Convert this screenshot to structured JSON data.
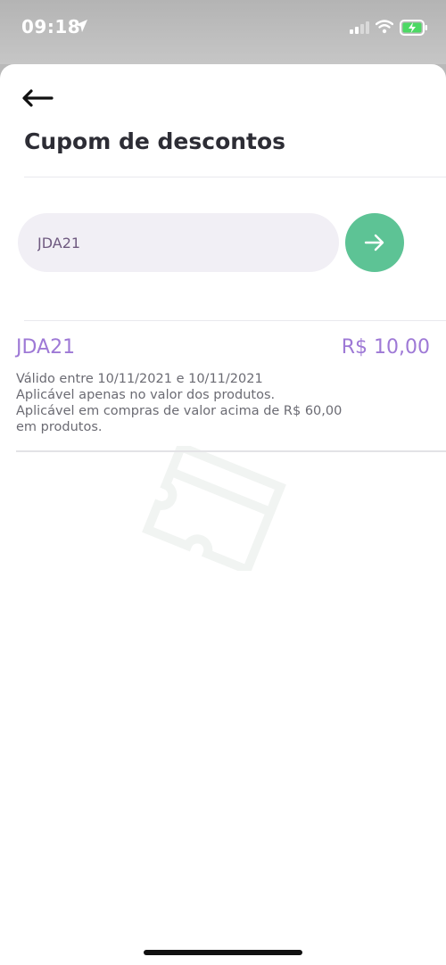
{
  "status_bar": {
    "time": "09:18",
    "icons": [
      "location-arrow-icon",
      "cell-signal-icon",
      "wifi-icon",
      "battery-charging-icon"
    ],
    "battery_color": "#4cd964"
  },
  "header": {
    "back_icon": "arrow-left-icon",
    "title": "Cupom de descontos"
  },
  "coupon_form": {
    "input_value": "JDA21",
    "submit_icon": "arrow-right-icon",
    "submit_color": "#5dc395"
  },
  "coupons": [
    {
      "code": "JDA21",
      "value": "R$ 10,00",
      "lines": [
        "Válido entre 10/11/2021 e 10/11/2021",
        "Aplicável apenas no valor dos produtos.",
        "Aplicável em compras de valor acima de R$ 60,00",
        "em produtos."
      ]
    }
  ],
  "colors": {
    "accent": "#9e79d6",
    "title": "#2d2d35",
    "input_bg": "#f1eff5"
  },
  "background_icon": "coupon-ticket-icon"
}
